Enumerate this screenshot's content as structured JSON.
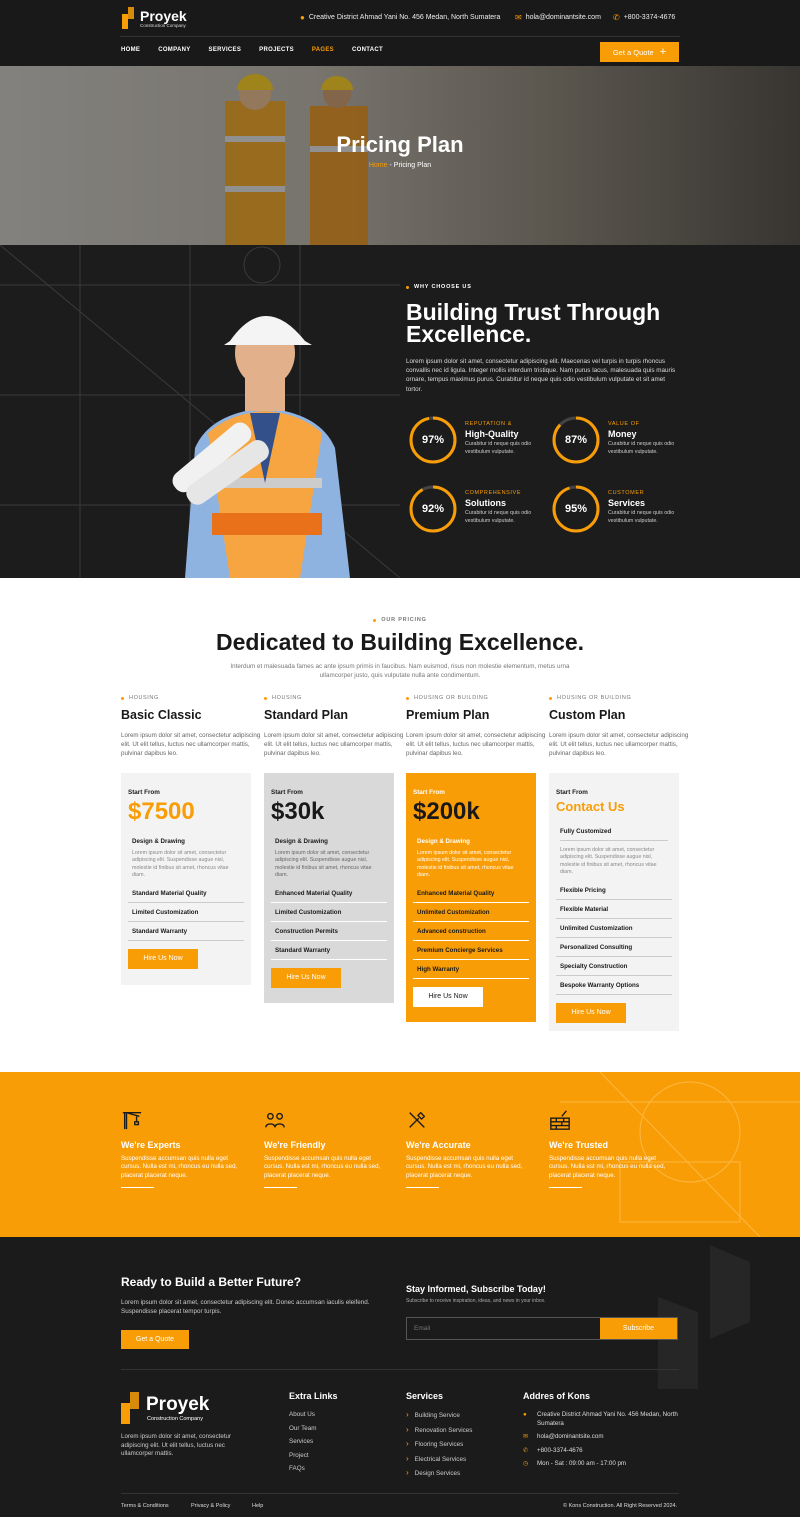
{
  "brand": {
    "name": "Proyek",
    "tagline": "Construction Company"
  },
  "header": {
    "address": "Creative District Ahmad Yani No. 456 Medan, North Sumatera",
    "email": "hola@dominantsite.com",
    "phone": "+800-3374-4676",
    "nav": [
      "HOME",
      "COMPANY",
      "SERVICES",
      "PROJECTS",
      "PAGES",
      "CONTACT"
    ],
    "active_nav": "PAGES",
    "cta": "Get a Quote"
  },
  "hero": {
    "title": "Pricing Plan",
    "crumb_home": "Home",
    "crumb_sep": " - ",
    "crumb_current": "Pricing Plan"
  },
  "why": {
    "tag": "WHY CHOOSE US",
    "title": "Building Trust Through Excellence.",
    "desc": "Lorem ipsum dolor sit amet, consectetur adipiscing elit. Maecenas vel turpis in turpis rhoncus convallis nec id ligula. Integer mollis interdum tristique. Nam purus lacus, malesuada quis mauris ornare, tempus maximus purus. Curabitur id neque quis odio vestibulum vulputate et sit amet tortor.",
    "stats": [
      {
        "value": "97%",
        "pct": 97,
        "kicker": "REPUTATION &",
        "title": "High-Quality",
        "desc": "Curabitur id neque quis odio vestibulum vulputate."
      },
      {
        "value": "87%",
        "pct": 87,
        "kicker": "VALUE OF",
        "title": "Money",
        "desc": "Curabitur id neque quis odio vestibulum vulputate."
      },
      {
        "value": "92%",
        "pct": 92,
        "kicker": "COMPREHENSIVE",
        "title": "Solutions",
        "desc": "Curabitur id neque quis odio vestibulum vulputate."
      },
      {
        "value": "95%",
        "pct": 95,
        "kicker": "CUSTOMER",
        "title": "Services",
        "desc": "Curabitur id neque quis odio vestibulum vulputate."
      }
    ]
  },
  "pricing": {
    "tag": "OUR PRICING",
    "title": "Dedicated to Building Excellence.",
    "desc": "Interdum et malesuada fames ac ante ipsum primis in faucibus. Nam euismod, risus non molestie elementum, metus urna ullamcorper justo, quis vulputate nulla ante condimentum.",
    "plans": [
      {
        "category": "HOUSING",
        "name": "Basic Classic",
        "desc": "Lorem ipsum dolor sit amet, consectetur adipiscing elit. Ut elit tellus, luctus nec ullamcorper mattis, pulvinar dapibus leo.",
        "start": "Start From",
        "price": "$7500",
        "feature_title": "Design & Drawing",
        "feature_desc": "Lorem ipsum dolor sit amet, consectetur adipiscing elit. Suspendisse augue nisl, molestie id finibus sit amet, rhoncus vitae diam.",
        "items": [
          "Standard Material Quality",
          "Limited Customization",
          "Standard Warranty"
        ],
        "button": "Hire Us Now"
      },
      {
        "category": "HOUSING",
        "name": "Standard Plan",
        "desc": "Lorem ipsum dolor sit amet, consectetur adipiscing elit. Ut elit tellus, luctus nec ullamcorper mattis, pulvinar dapibus leo.",
        "start": "Start From",
        "price": "$30k",
        "feature_title": "Design & Drawing",
        "feature_desc": "Lorem ipsum dolor sit amet, consectetur adipiscing elit. Suspendisse augue nisl, molestie id finibus sit amet, rhoncus vitae diam.",
        "items": [
          "Enhanced Material Quality",
          "Limited Customization",
          "Construction Permits",
          "Standard Warranty"
        ],
        "button": "Hire Us Now"
      },
      {
        "category": "HOUSING OR BUILDING",
        "name": "Premium Plan",
        "desc": "Lorem ipsum dolor sit amet, consectetur adipiscing elit. Ut elit tellus, luctus nec ullamcorper mattis, pulvinar dapibus leo.",
        "start": "Start From",
        "price": "$200k",
        "feature_title": "Design & Drawing",
        "feature_desc": "Lorem ipsum dolor sit amet, consectetur adipiscing elit. Suspendisse augue nisl, molestie id finibus sit amet, rhoncus vitae diam.",
        "items": [
          "Enhanced Material Quality",
          "Unlimited Customization",
          "Advanced construction",
          "Premium Concierge Services",
          "High Warranty"
        ],
        "button": "Hire Us Now"
      },
      {
        "category": "HOUSING OR BUILDING",
        "name": "Custom Plan",
        "desc": "Lorem ipsum dolor sit amet, consectetur adipiscing elit. Ut elit tellus, luctus nec ullamcorper mattis, pulvinar dapibus leo.",
        "start": "Start From",
        "price": "Contact Us",
        "feature_title": "Fully Customized",
        "feature_desc": "Lorem ipsum dolor sit amet, consectetur adipiscing elit. Suspendisse augue nisl, molestie id finibus sit amet, rhoncus vitae diam.",
        "items": [
          "Flexible Pricing",
          "Flexible Material",
          "Unlimited Customization",
          "Personalized Consulting",
          "Specialty Construction",
          "Bespoke Warranty Options"
        ],
        "button": "Hire Us Now"
      }
    ]
  },
  "features": [
    {
      "icon": "crane-icon",
      "title": "We're Experts",
      "desc": "Suspendisse accumsan quis nulla eget cursus. Nulla est mi, rhoncus eu nulla sed, placerat placerat neque."
    },
    {
      "icon": "team-icon",
      "title": "We're Friendly",
      "desc": "Suspendisse accumsan quis nulla eget cursus. Nulla est mi, rhoncus eu nulla sed, placerat placerat neque."
    },
    {
      "icon": "tools-icon",
      "title": "We're Accurate",
      "desc": "Suspendisse accumsan quis nulla eget cursus. Nulla est mi, rhoncus eu nulla sed, placerat placerat neque."
    },
    {
      "icon": "brick-wall-icon",
      "title": "We're Trusted",
      "desc": "Suspendisse accumsan quis nulla eget cursus. Nulla est mi, rhoncus eu nulla sed, placerat placerat neque."
    }
  ],
  "footer": {
    "cta_title": "Ready to Build a Better Future?",
    "cta_desc": "Lorem ipsum dolor sit amet, consectetur adipiscing elit. Donec accumsan iaculis eleifend. Suspendisse placerat tempor turpis.",
    "cta_button": "Get a Quote",
    "sub_title": "Stay Informed, Subscribe Today!",
    "sub_desc": "Subscribe to receive inspiration, ideas, and news in your inbox.",
    "email_placeholder": "Email",
    "sub_button": "Subscribe",
    "brand_desc": "Lorem ipsum dolor sit amet, consectetur adipiscing elit. Ut elit tellus, luctus nec ullamcorper mattis.",
    "extra_title": "Extra Links",
    "extra_links": [
      "About Us",
      "Our Team",
      "Services",
      "Project",
      "FAQs"
    ],
    "services_title": "Services",
    "services": [
      "Building Service",
      "Renovation Services",
      "Flooring Services",
      "Electrical Services",
      "Design Services"
    ],
    "address_title": "Addres of Kons",
    "address": "Creative District Ahmad Yani No. 456 Medan, North Sumatera",
    "email": "hola@dominantsite.com",
    "phone": "+800-3374-4676",
    "hours": "Mon - Sat : 09:00 am - 17:00 pm",
    "bottom_links": [
      "Terms & Conditions",
      "Privacy & Policy",
      "Help"
    ],
    "copyright": "© Kons Construction. All Right Reserved 2024."
  },
  "colors": {
    "accent": "#f99d07",
    "dark": "#1b1b1b",
    "light": "#f4f4f4",
    "grey_card": "#d9d9d9"
  }
}
